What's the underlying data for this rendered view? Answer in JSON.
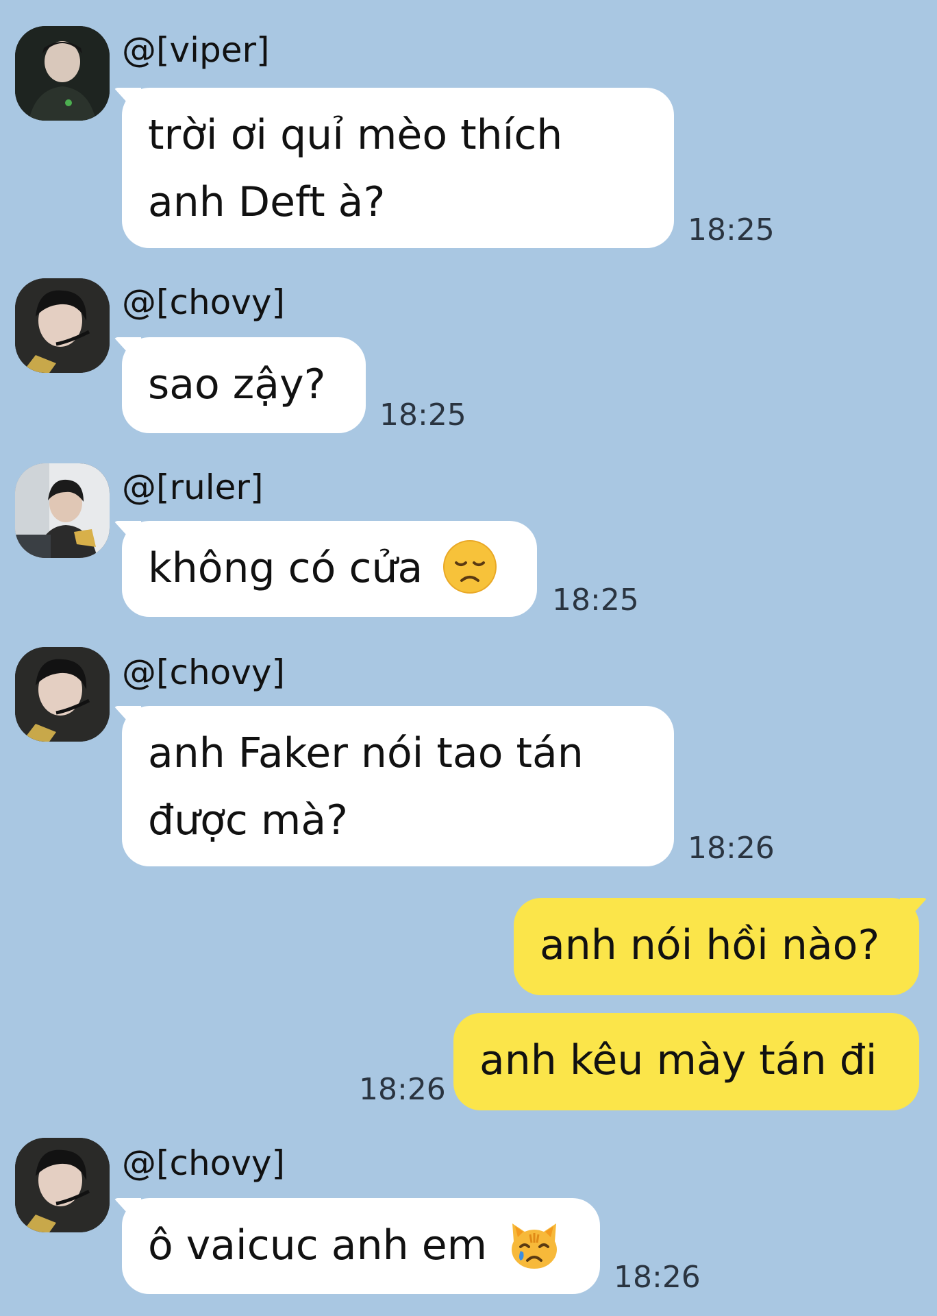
{
  "messages": [
    {
      "type": "incoming",
      "sender": "@[viper]",
      "avatar": "viper-avatar",
      "lines": [
        "trời ơi quỉ mèo thích",
        "anh Deft à?"
      ],
      "time": "18:25"
    },
    {
      "type": "incoming",
      "sender": "@[chovy]",
      "avatar": "chovy-avatar",
      "lines": [
        "sao zậy?"
      ],
      "time": "18:25"
    },
    {
      "type": "incoming",
      "sender": "@[ruler]",
      "avatar": "ruler-avatar",
      "lines": [
        "không có cửa"
      ],
      "emoji": "disappointed-face-emoji",
      "time": "18:25"
    },
    {
      "type": "incoming",
      "sender": "@[chovy]",
      "avatar": "chovy-avatar",
      "lines": [
        "anh Faker nói tao tán",
        "được mà?"
      ],
      "time": "18:26"
    },
    {
      "type": "outgoing",
      "lines": [
        "anh nói hồi nào?"
      ]
    },
    {
      "type": "outgoing",
      "lines": [
        "anh kêu mày tán đi"
      ],
      "time": "18:26"
    },
    {
      "type": "incoming",
      "sender": "@[chovy]",
      "avatar": "chovy-avatar",
      "lines": [
        "ô vaicuc anh em"
      ],
      "emoji": "crying-cat-face-emoji",
      "time": "18:26"
    }
  ],
  "colors": {
    "background": "#a9c7e2",
    "incoming_bubble": "#ffffff",
    "outgoing_bubble": "#fbe54a"
  }
}
